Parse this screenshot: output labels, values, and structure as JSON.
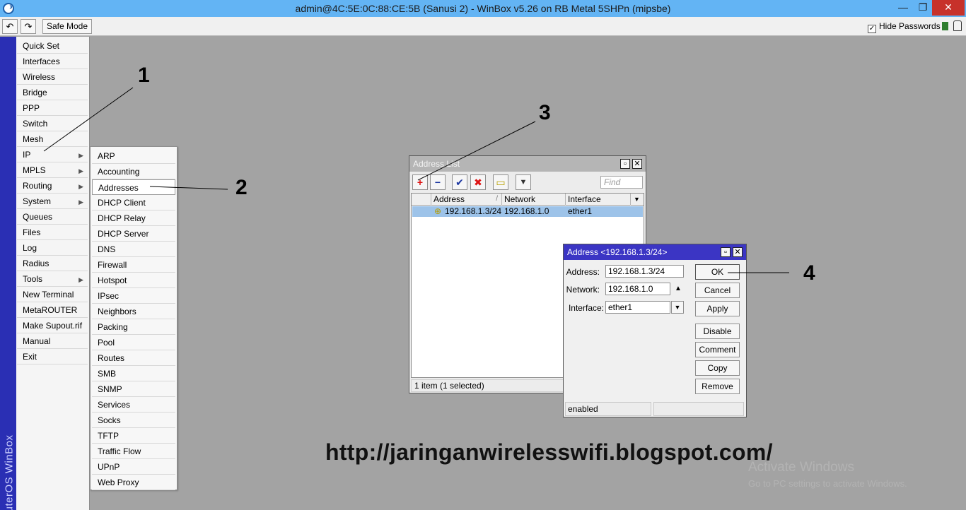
{
  "window": {
    "title": "admin@4C:5E:0C:88:CE:5B (Sanusi 2) - WinBox v5.26 on RB Metal 5SHPn (mipsbe)",
    "min_glyph": "—",
    "max_glyph": "❐",
    "close_glyph": "✕"
  },
  "toolbar": {
    "undo_glyph": "↶",
    "redo_glyph": "↷",
    "safe_mode_label": "Safe Mode",
    "hide_passwords_label": "Hide Passwords",
    "hide_passwords_checked": "✓"
  },
  "brand_text": "RouterOS WinBox",
  "main_menu": [
    {
      "label": "Quick Set",
      "arrow": ""
    },
    {
      "label": "Interfaces",
      "arrow": ""
    },
    {
      "label": "Wireless",
      "arrow": ""
    },
    {
      "label": "Bridge",
      "arrow": ""
    },
    {
      "label": "PPP",
      "arrow": ""
    },
    {
      "label": "Switch",
      "arrow": ""
    },
    {
      "label": "Mesh",
      "arrow": ""
    },
    {
      "label": "IP",
      "arrow": "▶"
    },
    {
      "label": "MPLS",
      "arrow": "▶"
    },
    {
      "label": "Routing",
      "arrow": "▶"
    },
    {
      "label": "System",
      "arrow": "▶"
    },
    {
      "label": "Queues",
      "arrow": ""
    },
    {
      "label": "Files",
      "arrow": ""
    },
    {
      "label": "Log",
      "arrow": ""
    },
    {
      "label": "Radius",
      "arrow": ""
    },
    {
      "label": "Tools",
      "arrow": "▶"
    },
    {
      "label": "New Terminal",
      "arrow": ""
    },
    {
      "label": "MetaROUTER",
      "arrow": ""
    },
    {
      "label": "Make Supout.rif",
      "arrow": ""
    },
    {
      "label": "Manual",
      "arrow": ""
    },
    {
      "label": "Exit",
      "arrow": ""
    }
  ],
  "ip_submenu": [
    "ARP",
    "Accounting",
    "Addresses",
    "DHCP Client",
    "DHCP Relay",
    "DHCP Server",
    "DNS",
    "Firewall",
    "Hotspot",
    "IPsec",
    "Neighbors",
    "Packing",
    "Pool",
    "Routes",
    "SMB",
    "SNMP",
    "Services",
    "Socks",
    "TFTP",
    "Traffic Flow",
    "UPnP",
    "Web Proxy"
  ],
  "address_list": {
    "title": "Address List",
    "find_placeholder": "Find",
    "toolbar_glyphs": {
      "add": "+",
      "remove": "−",
      "enable": "✔",
      "disable": "✖",
      "comment": "▭",
      "filter": "▼"
    },
    "columns": {
      "address": "Address",
      "sort_mark": "/",
      "network": "Network",
      "interface": "Interface",
      "dropdown": "▼"
    },
    "rows": [
      {
        "address": "192.168.1.3/24",
        "network": "192.168.1.0",
        "interface": "ether1",
        "flag_glyph": "⊕"
      }
    ],
    "status": "1 item (1 selected)"
  },
  "address_dialog": {
    "title": "Address <192.168.1.3/24>",
    "address_label": "Address:",
    "address_value": "192.168.1.3/24",
    "network_label": "Network:",
    "network_value": "192.168.1.0",
    "network_toggle_glyph": "▲",
    "interface_label": "Interface:",
    "interface_value": "ether1",
    "interface_dropdown_glyph": "▼",
    "buttons": {
      "ok": "OK",
      "cancel": "Cancel",
      "apply": "Apply",
      "disable": "Disable",
      "comment": "Comment",
      "copy": "Copy",
      "remove": "Remove"
    },
    "status_left": "enabled",
    "status_right": ""
  },
  "annotations": {
    "n1": "1",
    "n2": "2",
    "n3": "3",
    "n4": "4"
  },
  "blog_url": "http://jaringanwirelesswifi.blogspot.com/",
  "watermark": {
    "title": "Activate Windows",
    "subtitle": "Go to PC settings to activate Windows."
  },
  "colors": {
    "titlebar": "#63b4f4",
    "brand_strip": "#2a2fb4",
    "dialog_title": "#3b35c4",
    "selected_row": "#9dc3e9",
    "close_button": "#c7312a"
  }
}
